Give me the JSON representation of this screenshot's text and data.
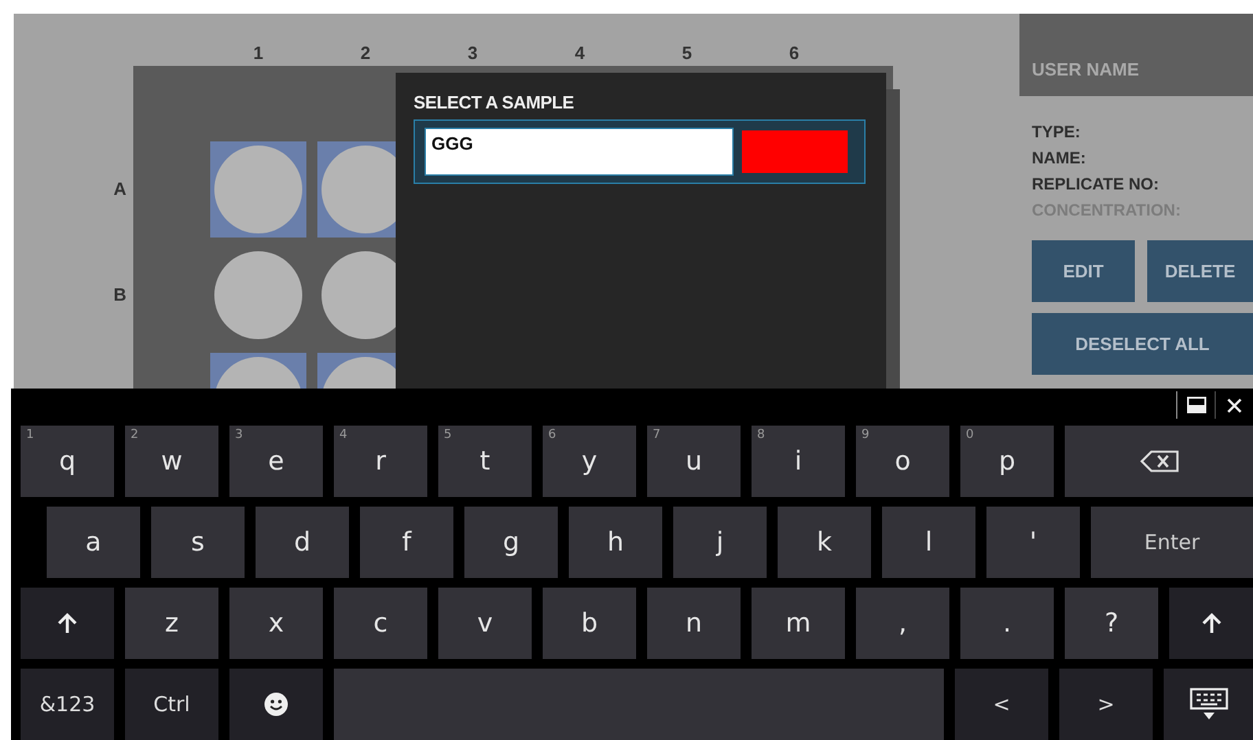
{
  "plate": {
    "columns": [
      "1",
      "2",
      "3",
      "4",
      "5",
      "6"
    ],
    "rows": [
      {
        "label": "A",
        "wells": [
          {
            "selected": true
          },
          {
            "selected": true
          }
        ]
      },
      {
        "label": "B",
        "wells": [
          {
            "selected": false
          },
          {
            "selected": false
          }
        ]
      },
      {
        "wells": [
          {
            "selected": true
          },
          {
            "selected": true
          }
        ]
      }
    ]
  },
  "dialog": {
    "title": "SELECT A SAMPLE",
    "value": "GGG",
    "color": "#ff0000"
  },
  "side_panel": {
    "user_name": "USER NAME",
    "fields": [
      {
        "text": "TYPE:",
        "disabled": false
      },
      {
        "text": "NAME:",
        "disabled": false
      },
      {
        "text": "REPLICATE NO:",
        "disabled": false
      },
      {
        "text": "CONCENTRATION:",
        "disabled": true
      }
    ],
    "buttons": [
      "EDIT",
      "DELETE"
    ],
    "wide_button": "DESELECT ALL"
  },
  "keyboard": {
    "rows": [
      {
        "keys": [
          {
            "kind": "char",
            "label": "q",
            "hint": "1"
          },
          {
            "kind": "char",
            "label": "w",
            "hint": "2"
          },
          {
            "kind": "char",
            "label": "e",
            "hint": "3"
          },
          {
            "kind": "char",
            "label": "r",
            "hint": "4"
          },
          {
            "kind": "char",
            "label": "t",
            "hint": "5"
          },
          {
            "kind": "char",
            "label": "y",
            "hint": "6"
          },
          {
            "kind": "char",
            "label": "u",
            "hint": "7"
          },
          {
            "kind": "char",
            "label": "i",
            "hint": "8"
          },
          {
            "kind": "char",
            "label": "o",
            "hint": "9"
          },
          {
            "kind": "char",
            "label": "p",
            "hint": "0"
          },
          {
            "kind": "backspace"
          }
        ]
      },
      {
        "keys": [
          {
            "kind": "char",
            "label": "a"
          },
          {
            "kind": "char",
            "label": "s"
          },
          {
            "kind": "char",
            "label": "d"
          },
          {
            "kind": "char",
            "label": "f"
          },
          {
            "kind": "char",
            "label": "g"
          },
          {
            "kind": "char",
            "label": "h"
          },
          {
            "kind": "char",
            "label": "j"
          },
          {
            "kind": "char",
            "label": "k"
          },
          {
            "kind": "char",
            "label": "l"
          },
          {
            "kind": "char",
            "label": "'"
          },
          {
            "kind": "enter",
            "label": "Enter"
          }
        ]
      },
      {
        "keys": [
          {
            "kind": "shift"
          },
          {
            "kind": "char",
            "label": "z"
          },
          {
            "kind": "char",
            "label": "x"
          },
          {
            "kind": "char",
            "label": "c"
          },
          {
            "kind": "char",
            "label": "v"
          },
          {
            "kind": "char",
            "label": "b"
          },
          {
            "kind": "char",
            "label": "n"
          },
          {
            "kind": "char",
            "label": "m"
          },
          {
            "kind": "char",
            "label": ","
          },
          {
            "kind": "char",
            "label": "."
          },
          {
            "kind": "char",
            "label": "?"
          },
          {
            "kind": "shift"
          }
        ]
      },
      {
        "keys": [
          {
            "kind": "fn",
            "label": "&123"
          },
          {
            "kind": "fn",
            "label": "Ctrl"
          },
          {
            "kind": "emoji"
          },
          {
            "kind": "space"
          },
          {
            "kind": "fn",
            "label": "<"
          },
          {
            "kind": "fn",
            "label": ">"
          },
          {
            "kind": "hide"
          }
        ]
      }
    ]
  }
}
